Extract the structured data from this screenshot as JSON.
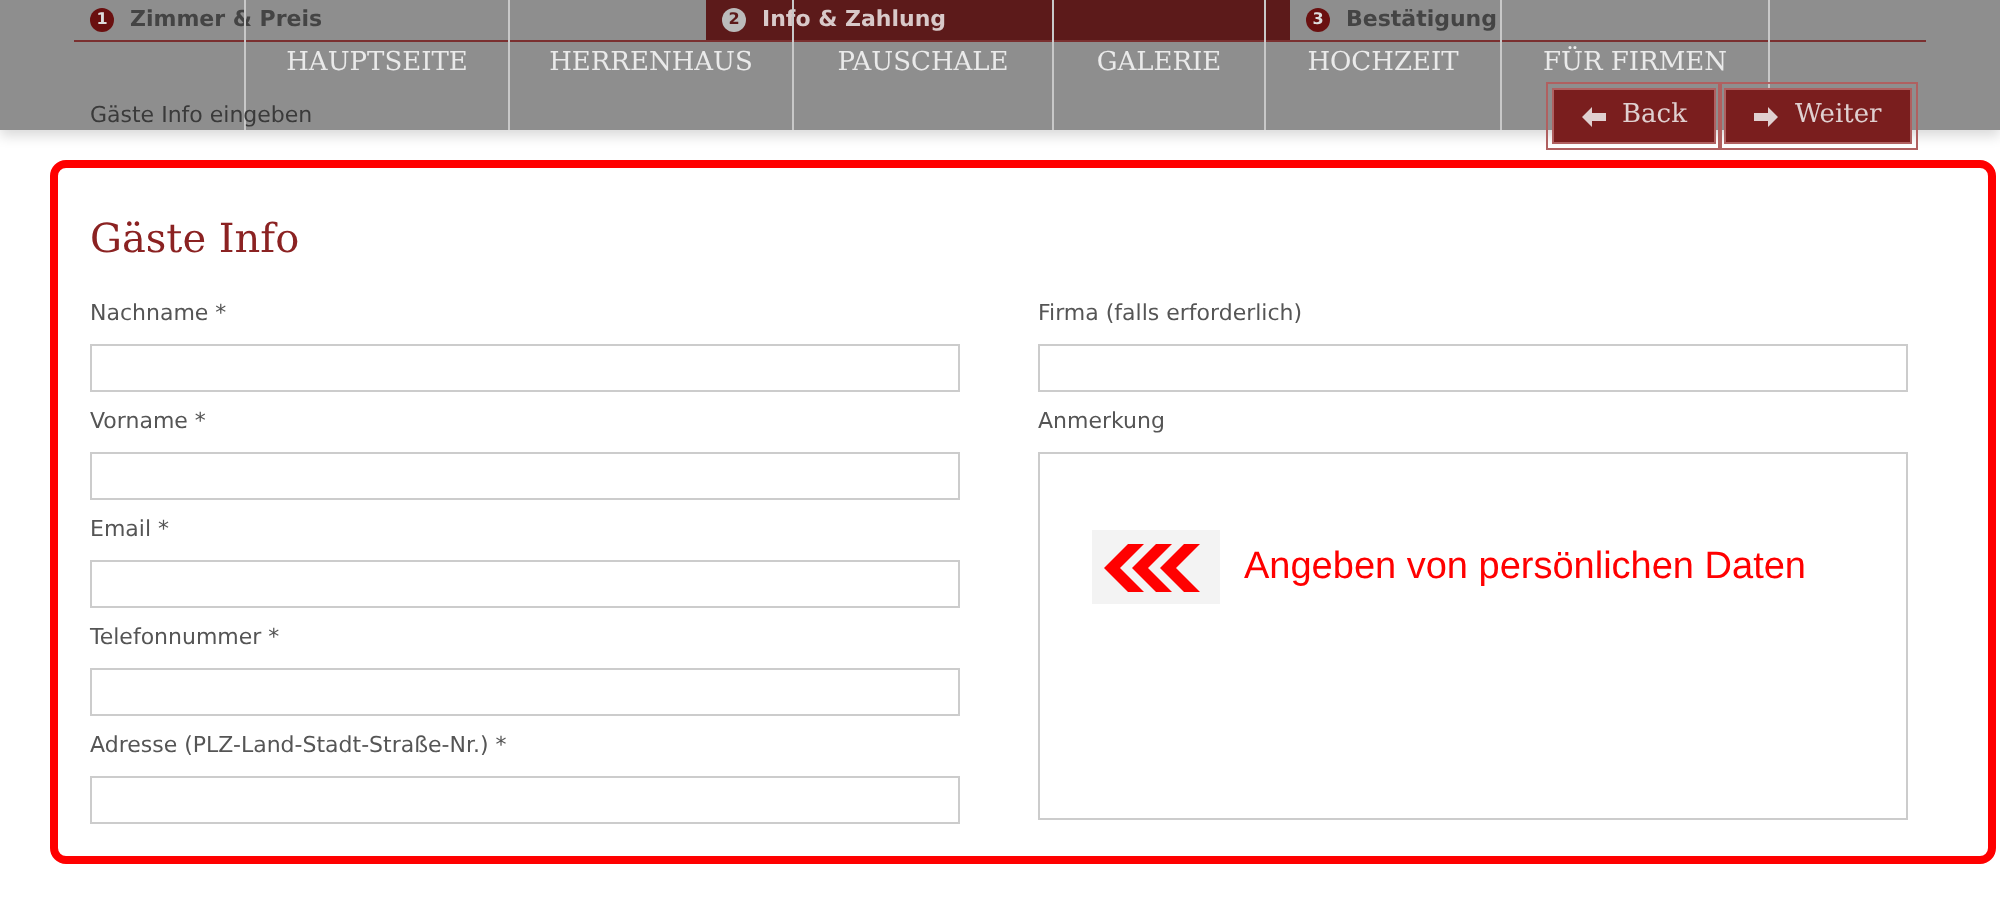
{
  "steps": [
    {
      "number": "1",
      "label": "Zimmer & Preis",
      "selected": false
    },
    {
      "number": "2",
      "label": "Info & Zahlung",
      "selected": true
    },
    {
      "number": "3",
      "label": "Bestätigung",
      "selected": false
    }
  ],
  "nav": [
    "HAUPTSEITE",
    "HERRENHAUS",
    "PAUSCHALE",
    "GALERIE",
    "HOCHZEIT",
    "FÜR FIRMEN"
  ],
  "breadcrumb": "Gäste Info eingeben",
  "buttons": [
    {
      "label": "Back",
      "kind": "back"
    },
    {
      "label": "Weiter",
      "kind": "next"
    }
  ],
  "section_title": "Gäste Info",
  "left_fields": [
    {
      "label": "Nachname *"
    },
    {
      "label": "Vorname *"
    },
    {
      "label": "Email *"
    },
    {
      "label": "Telefonnummer *"
    },
    {
      "label": "Adresse (PLZ-Land-Stadt-Straße-Nr.) *"
    }
  ],
  "right_fields": [
    {
      "label": "Firma (falls erforderlich)",
      "kind": "input"
    },
    {
      "label": "Anmerkung",
      "kind": "textarea"
    }
  ],
  "annotation": "Angeben von persönlichen Daten"
}
